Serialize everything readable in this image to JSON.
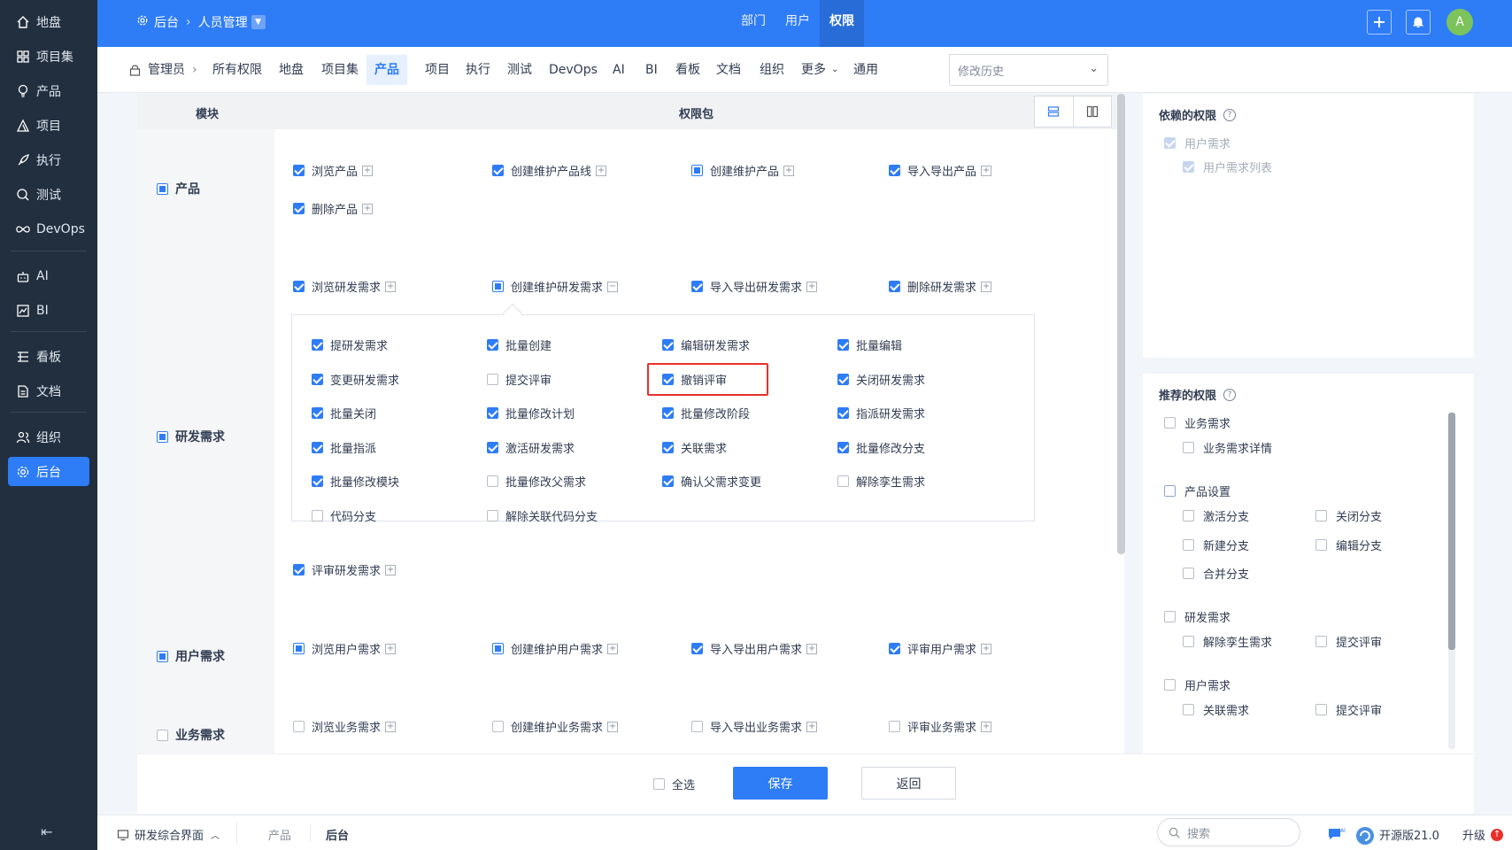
{
  "sidebar": {
    "items": [
      {
        "label": "地盘",
        "icon": "home-icon"
      },
      {
        "label": "项目集",
        "icon": "grid-icon"
      },
      {
        "label": "产品",
        "icon": "bulb-icon"
      },
      {
        "label": "项目",
        "icon": "project-icon"
      },
      {
        "label": "执行",
        "icon": "rocket-icon"
      },
      {
        "label": "测试",
        "icon": "test-icon"
      },
      {
        "label": "DevOps",
        "icon": "infinity-icon"
      },
      {
        "label": "AI",
        "icon": "robot-icon"
      },
      {
        "label": "BI",
        "icon": "chart-icon"
      },
      {
        "label": "看板",
        "icon": "kanban-icon"
      },
      {
        "label": "文档",
        "icon": "doc-icon"
      },
      {
        "label": "组织",
        "icon": "people-icon"
      },
      {
        "label": "后台",
        "icon": "gear-icon"
      }
    ],
    "active": "后台"
  },
  "topbar": {
    "crumb_root": "后台",
    "crumb_current": "人员管理",
    "nav": [
      "部门",
      "用户",
      "权限"
    ],
    "nav_active": "权限",
    "avatar": "A"
  },
  "tabs": {
    "lead": "管理员",
    "items": [
      "所有权限",
      "地盘",
      "项目集",
      "产品",
      "项目",
      "执行",
      "测试",
      "DevOps",
      "AI",
      "BI",
      "看板",
      "文档",
      "组织",
      "更多",
      "通用"
    ],
    "active": "产品",
    "history_placeholder": "修改历史"
  },
  "table": {
    "col_module": "模块",
    "col_package": "权限包"
  },
  "modules": [
    {
      "label": "产品",
      "state": "half"
    },
    {
      "label": "研发需求",
      "state": "half"
    },
    {
      "label": "用户需求",
      "state": "half"
    },
    {
      "label": "业务需求",
      "state": "none"
    }
  ],
  "product_perms": [
    {
      "label": "浏览产品",
      "state": "on",
      "toggle": "+"
    },
    {
      "label": "创建维护产品线",
      "state": "on",
      "toggle": "+"
    },
    {
      "label": "创建维护产品",
      "state": "half",
      "toggle": "+"
    },
    {
      "label": "导入导出产品",
      "state": "on",
      "toggle": "+"
    },
    {
      "label": "删除产品",
      "state": "on",
      "toggle": "+"
    }
  ],
  "story_perms": [
    {
      "label": "浏览研发需求",
      "state": "on",
      "toggle": "+"
    },
    {
      "label": "创建维护研发需求",
      "state": "half",
      "toggle": "−"
    },
    {
      "label": "导入导出研发需求",
      "state": "on",
      "toggle": "+"
    },
    {
      "label": "删除研发需求",
      "state": "on",
      "toggle": "+"
    }
  ],
  "story_sub": [
    {
      "label": "提研发需求",
      "state": "on"
    },
    {
      "label": "批量创建",
      "state": "on"
    },
    {
      "label": "编辑研发需求",
      "state": "on"
    },
    {
      "label": "批量编辑",
      "state": "on"
    },
    {
      "label": "变更研发需求",
      "state": "on"
    },
    {
      "label": "提交评审",
      "state": "off"
    },
    {
      "label": "撤销评审",
      "state": "on"
    },
    {
      "label": "关闭研发需求",
      "state": "on"
    },
    {
      "label": "批量关闭",
      "state": "on"
    },
    {
      "label": "批量修改计划",
      "state": "on"
    },
    {
      "label": "批量修改阶段",
      "state": "on"
    },
    {
      "label": "指派研发需求",
      "state": "on"
    },
    {
      "label": "批量指派",
      "state": "on"
    },
    {
      "label": "激活研发需求",
      "state": "on"
    },
    {
      "label": "关联需求",
      "state": "on"
    },
    {
      "label": "批量修改分支",
      "state": "on"
    },
    {
      "label": "批量修改模块",
      "state": "on"
    },
    {
      "label": "批量修改父需求",
      "state": "off"
    },
    {
      "label": "确认父需求变更",
      "state": "on"
    },
    {
      "label": "解除孪生需求",
      "state": "off"
    },
    {
      "label": "代码分支",
      "state": "off"
    },
    {
      "label": "解除关联代码分支",
      "state": "off"
    }
  ],
  "story_review": {
    "label": "评审研发需求",
    "state": "on",
    "toggle": "+"
  },
  "requirement_perms": [
    {
      "label": "浏览用户需求",
      "state": "half",
      "toggle": "+"
    },
    {
      "label": "创建维护用户需求",
      "state": "half",
      "toggle": "+"
    },
    {
      "label": "导入导出用户需求",
      "state": "on",
      "toggle": "+"
    },
    {
      "label": "评审用户需求",
      "state": "on",
      "toggle": "+"
    }
  ],
  "epic_perms": [
    {
      "label": "浏览业务需求",
      "state": "off",
      "toggle": "+"
    },
    {
      "label": "创建维护业务需求",
      "state": "off",
      "toggle": "+"
    },
    {
      "label": "导入导出业务需求",
      "state": "off",
      "toggle": "+"
    },
    {
      "label": "评审业务需求",
      "state": "off",
      "toggle": "+"
    }
  ],
  "footer": {
    "select_all": "全选",
    "save": "保存",
    "back": "返回"
  },
  "depends": {
    "title": "依赖的权限",
    "items": [
      "用户需求",
      "用户需求列表"
    ]
  },
  "recommend": {
    "title": "推荐的权限",
    "groups": [
      {
        "label": "业务需求",
        "children": [
          "业务需求详情"
        ]
      },
      {
        "label": "产品设置",
        "children": [
          "激活分支",
          "关闭分支",
          "新建分支",
          "编辑分支",
          "合并分支"
        ]
      },
      {
        "label": "研发需求",
        "children": [
          "解除孪生需求",
          "提交评审"
        ]
      },
      {
        "label": "用户需求",
        "children": [
          "关联需求",
          "提交评审"
        ]
      }
    ]
  },
  "bottombar": {
    "view": "研发综合界面",
    "crumb1": "产品",
    "crumb2": "后台",
    "search_placeholder": "搜索",
    "version": "开源版21.0",
    "upgrade": "升级"
  },
  "colors": {
    "primary": "#2e7cf6",
    "sidebar": "#222f3f",
    "highlight": "#e8302a"
  }
}
